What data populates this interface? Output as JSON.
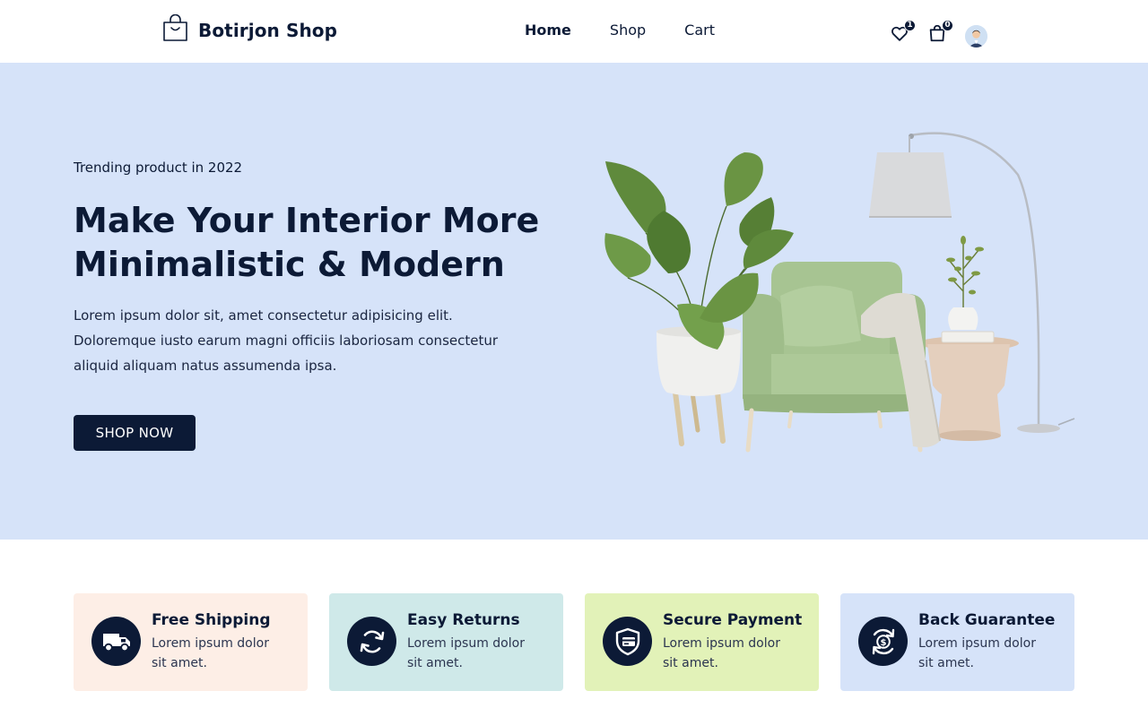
{
  "header": {
    "brand": "Botirjon Shop",
    "brand_icon": "shopping-bag-icon",
    "nav": [
      {
        "label": "Home",
        "active": true
      },
      {
        "label": "Shop",
        "active": false
      },
      {
        "label": "Cart",
        "active": false
      }
    ],
    "wishlist_count": "1",
    "cart_count": "0",
    "icons": [
      "heart-icon",
      "bag-icon",
      "user-avatar"
    ]
  },
  "hero": {
    "eyebrow": "Trending product in 2022",
    "title_lines": [
      "Make Your Interior More",
      "Minimalistic & Modern"
    ],
    "description_lines": [
      "Lorem ipsum dolor sit, amet consectetur adipisicing elit.",
      "Doloremque iusto earum magni officiis laboriosam consectetur",
      "aliquid aliquam natus assumenda ipsa."
    ],
    "cta": "SHOP NOW",
    "background": "#d6e3f9"
  },
  "features": [
    {
      "title": "Free Shipping",
      "text_lines": [
        "Lorem ipsum dolor",
        "sit amet."
      ],
      "icon": "truck-icon",
      "color": "#fdeee6"
    },
    {
      "title": "Easy Returns",
      "text_lines": [
        "Lorem ipsum dolor",
        "sit amet."
      ],
      "icon": "refresh-icon",
      "color": "#cfe9e9"
    },
    {
      "title": "Secure Payment",
      "text_lines": [
        "Lorem ipsum dolor",
        "sit amet."
      ],
      "icon": "shield-card-icon",
      "color": "#e2f2b8"
    },
    {
      "title": "Back Guarantee",
      "text_lines": [
        "Lorem ipsum dolor",
        "sit amet."
      ],
      "icon": "money-back-icon",
      "color": "#d6e3f9"
    }
  ],
  "colors": {
    "primary": "#0c1a36"
  }
}
